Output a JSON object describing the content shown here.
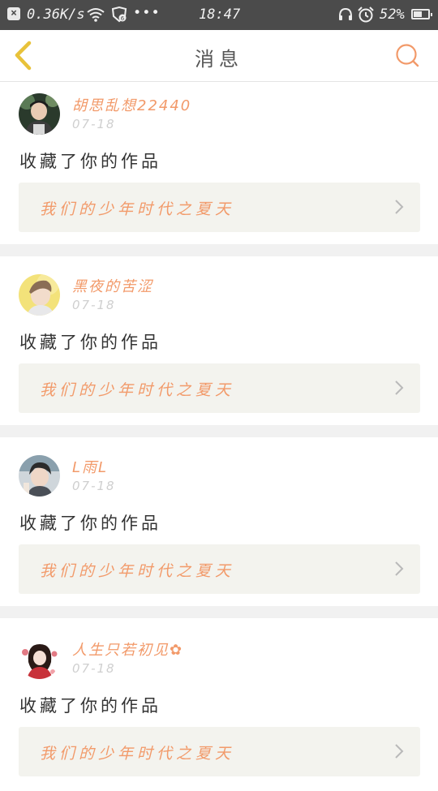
{
  "status_bar": {
    "speed": "0.36K/s",
    "time": "18:47",
    "battery": "52%",
    "icons": [
      "close-icon",
      "wifi-icon",
      "shield-icon",
      "more-dots-icon",
      "headset-icon",
      "alarm-icon",
      "battery-icon"
    ]
  },
  "header": {
    "title": "消息",
    "back_icon": "chevron-left-icon",
    "search_icon": "search-icon"
  },
  "colors": {
    "accent": "#f29a6a",
    "back_arrow": "#e8c23a",
    "status_bar_bg": "#4b4b4b",
    "card_bg": "#f3f3ee",
    "divider": "#f1f1f1"
  },
  "messages": [
    {
      "username": "胡思乱想22440",
      "date": "07-18",
      "action": "收藏了你的作品",
      "work_title": "我们的少年时代之夏天"
    },
    {
      "username": "黑夜的苦涩",
      "date": "07-18",
      "action": "收藏了你的作品",
      "work_title": "我们的少年时代之夏天"
    },
    {
      "username": "L雨L",
      "date": "07-18",
      "action": "收藏了你的作品",
      "work_title": "我们的少年时代之夏天"
    },
    {
      "username": "人生只若初见✿",
      "date": "07-18",
      "action": "收藏了你的作品",
      "work_title": "我们的少年时代之夏天"
    }
  ]
}
